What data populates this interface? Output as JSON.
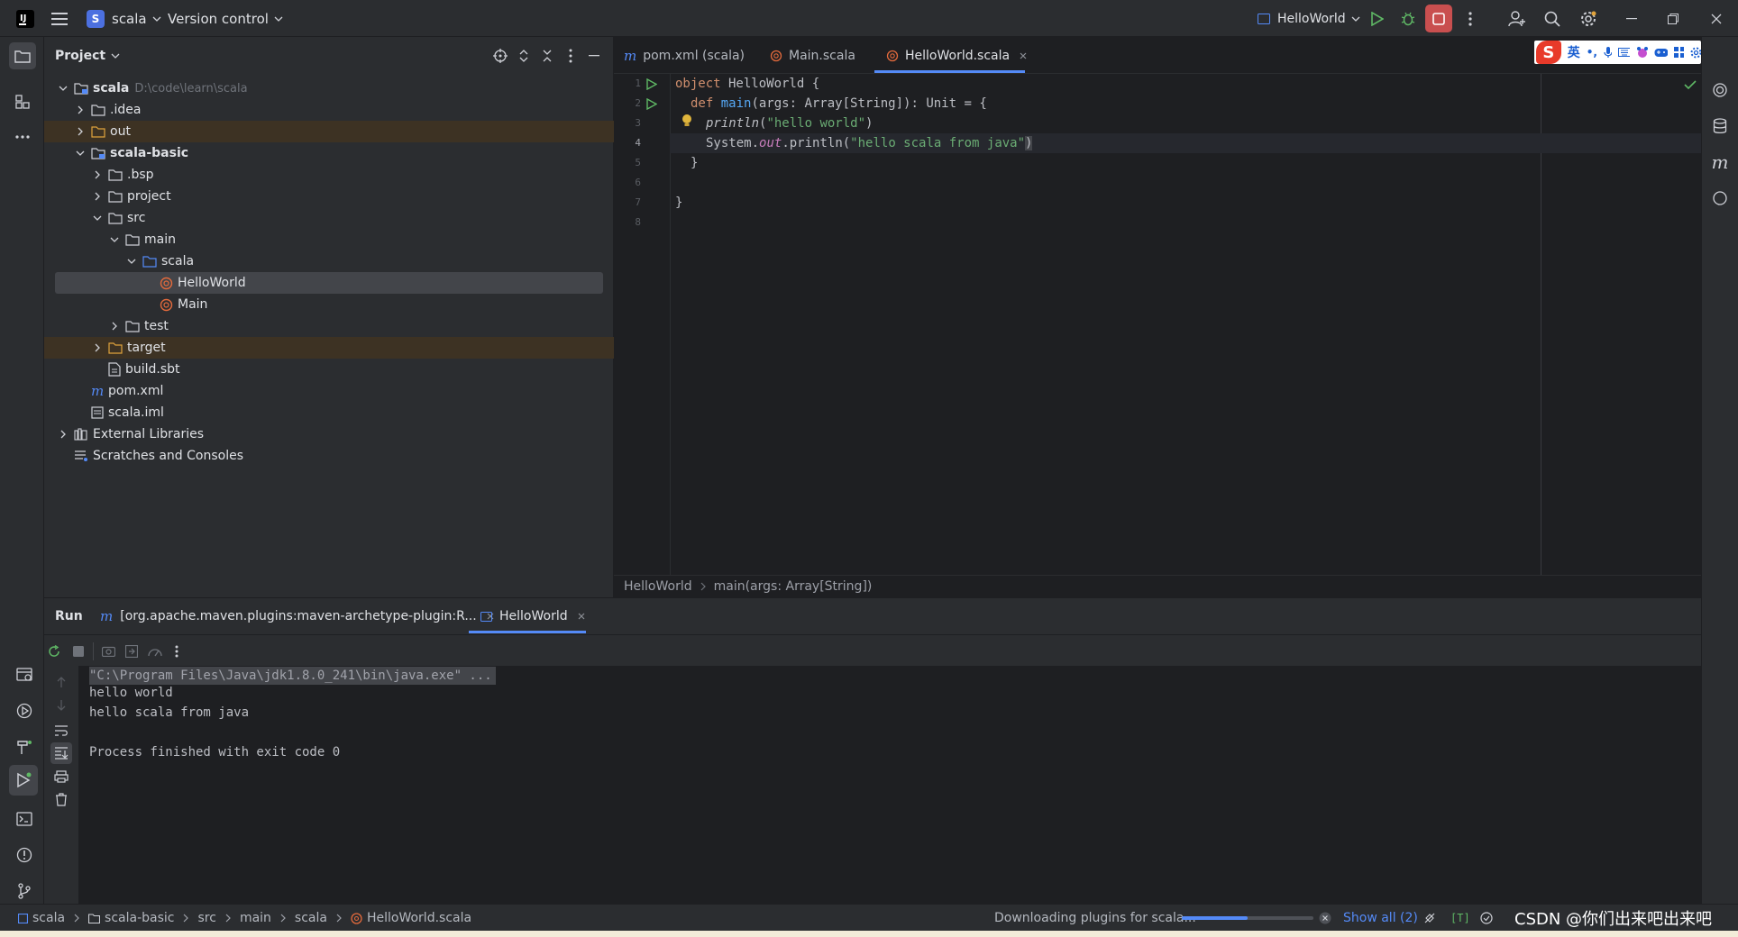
{
  "titlebar": {
    "project_badge": "S",
    "project_name": "scala",
    "vcs_label": "Version control",
    "run_config": "HelloWorld",
    "colors": {
      "badge": "#4c70e0",
      "stop": "#c94f4f",
      "run": "#5fb865"
    }
  },
  "project_panel": {
    "title": "Project",
    "rows": [
      {
        "label": "scala",
        "suffix": "D:\\code\\learn\\scala",
        "bold": true
      },
      {
        "label": ".idea"
      },
      {
        "label": "out"
      },
      {
        "label": "scala-basic",
        "bold": true
      },
      {
        "label": ".bsp"
      },
      {
        "label": "project"
      },
      {
        "label": "src"
      },
      {
        "label": "main"
      },
      {
        "label": "scala"
      },
      {
        "label": "HelloWorld"
      },
      {
        "label": "Main"
      },
      {
        "label": "test"
      },
      {
        "label": "target"
      },
      {
        "label": "build.sbt"
      },
      {
        "label": "pom.xml"
      },
      {
        "label": "scala.iml"
      },
      {
        "label": "External Libraries"
      },
      {
        "label": "Scratches and Consoles"
      }
    ]
  },
  "editor": {
    "tabs": [
      {
        "label": "pom.xml (scala)",
        "icon": "maven-icon"
      },
      {
        "label": "Main.scala",
        "icon": "scala-object-icon"
      },
      {
        "label": "HelloWorld.scala",
        "icon": "scala-object-icon",
        "active": true
      }
    ],
    "line_numbers": [
      "1",
      "2",
      "3",
      "4",
      "5",
      "6",
      "7",
      "8"
    ],
    "code": {
      "l1_kw": "object",
      "l1_rest": " HelloWorld {",
      "l2_kw": "def",
      "l2_fn": "main",
      "l2_rest": "(args: Array[String]): Unit = {",
      "l3_fn": "println",
      "l3_str": "\"hello world\"",
      "l4_obj": "System.",
      "l4_field": "out",
      "l4_call": ".println(",
      "l4_str": "\"hello scala from java\"",
      "l4_close": ")",
      "l5": "}",
      "l7": "}"
    },
    "breadcrumb": [
      "HelloWorld",
      "main(args: Array[String])"
    ]
  },
  "run_panel": {
    "title": "Run",
    "tabs": [
      {
        "label": "[org.apache.maven.plugins:maven-archetype-plugin:R..."
      },
      {
        "label": "HelloWorld",
        "active": true
      }
    ],
    "console": [
      "\"C:\\Program Files\\Java\\jdk1.8.0_241\\bin\\java.exe\" ...",
      "hello world",
      "hello scala from java",
      "",
      "Process finished with exit code 0"
    ]
  },
  "statusbar": {
    "breadcrumb": [
      "scala",
      "scala-basic",
      "src",
      "main",
      "scala",
      "HelloWorld.scala"
    ],
    "task": "Downloading plugins for scala...",
    "progress": 0.5,
    "show_all": "Show all (2)",
    "watermark": "CSDN @你们出来吧出来吧"
  },
  "ime": {
    "label": "英"
  }
}
